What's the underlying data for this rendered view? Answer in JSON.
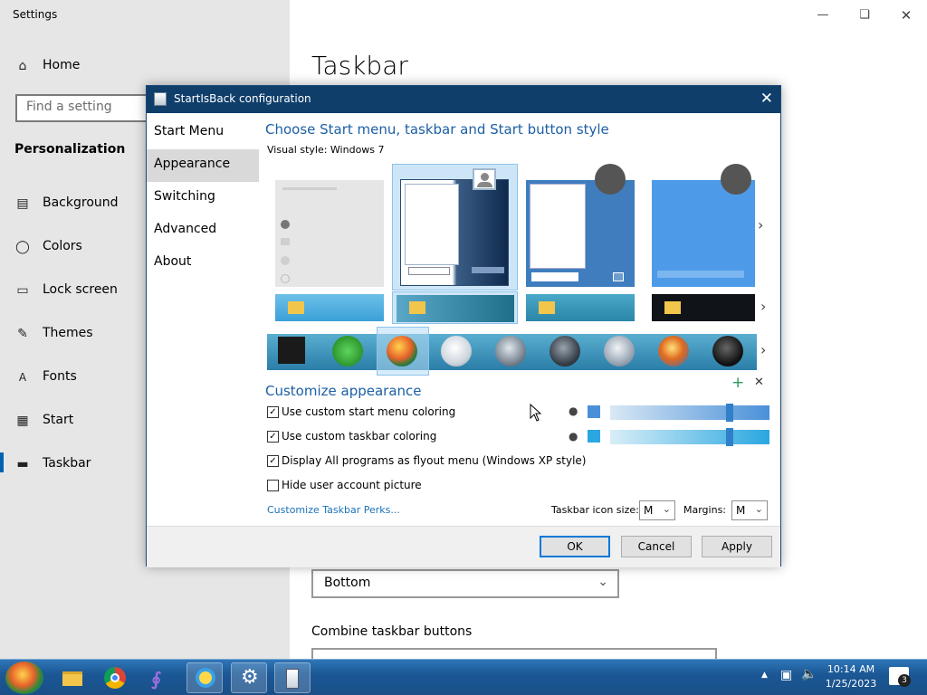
{
  "settings": {
    "window_title": "Settings",
    "home_label": "Home",
    "search_placeholder": "Find a setting",
    "section_heading": "Personalization",
    "nav_items": [
      {
        "label": "Background",
        "icon": "picture-icon"
      },
      {
        "label": "Colors",
        "icon": "palette-icon"
      },
      {
        "label": "Lock screen",
        "icon": "lock-screen-icon"
      },
      {
        "label": "Themes",
        "icon": "brush-icon"
      },
      {
        "label": "Fonts",
        "icon": "font-icon"
      },
      {
        "label": "Start",
        "icon": "start-grid-icon"
      },
      {
        "label": "Taskbar",
        "icon": "taskbar-icon",
        "active": true
      }
    ],
    "page_title": "Taskbar",
    "position_value": "Bottom",
    "combine_label": "Combine taskbar buttons",
    "accent_color": "#0063b1"
  },
  "dialog": {
    "title": "StartIsBack configuration",
    "sidebar": [
      "Start Menu",
      "Appearance",
      "Switching",
      "Advanced",
      "About"
    ],
    "selected_tab": "Appearance",
    "heading": "Choose Start menu, taskbar and Start button style",
    "visual_style_label": "Visual style:",
    "visual_style_value": "Windows 7",
    "customize_heading": "Customize appearance",
    "options": [
      {
        "label": "Use custom start menu coloring",
        "checked": true
      },
      {
        "label": "Use custom taskbar coloring",
        "checked": true
      },
      {
        "label": "Display All programs as flyout menu (Windows XP style)",
        "checked": true
      },
      {
        "label": "Hide user account picture",
        "checked": false
      }
    ],
    "start_menu_color": "#4a90d9",
    "taskbar_color": "#2aa7e0",
    "perks_link": "Customize Taskbar Perks...",
    "icon_size_label": "Taskbar icon size:",
    "icon_size_value": "M",
    "margins_label": "Margins:",
    "margins_value": "M",
    "buttons": {
      "ok": "OK",
      "cancel": "Cancel",
      "apply": "Apply"
    }
  },
  "taskbar": {
    "apps": [
      "start-orb",
      "file-explorer",
      "chrome",
      "visual-studio",
      "internet-explorer",
      "settings",
      "startisback"
    ],
    "time": "10:14 AM",
    "date": "1/25/2023",
    "notification_count": "3"
  }
}
